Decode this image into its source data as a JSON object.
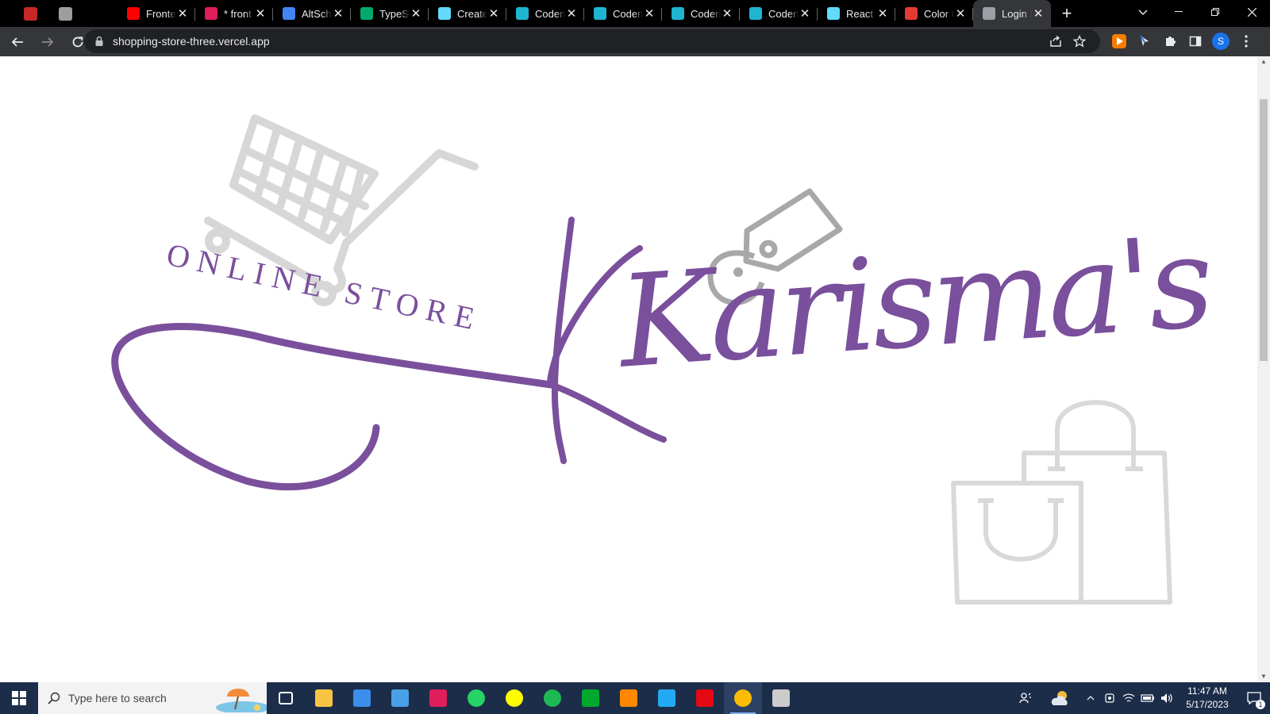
{
  "browser": {
    "pinned_tabs": [
      {
        "name": "pinned-tab-1",
        "color": "#c62828"
      },
      {
        "name": "pinned-tab-2",
        "color": "#9e9e9e"
      },
      {
        "name": "pinned-tab-3",
        "color": "#000000"
      }
    ],
    "tabs": [
      {
        "title": "Fronte",
        "icon": "youtube-icon",
        "color": "#ff0000"
      },
      {
        "title": "* front",
        "icon": "slack-icon",
        "color": "#e01e5a"
      },
      {
        "title": "AltSch",
        "icon": "docs-icon",
        "color": "#4285f4"
      },
      {
        "title": "TypeSc",
        "icon": "w3-icon",
        "color": "#04aa6d"
      },
      {
        "title": "Create",
        "icon": "react-icon",
        "color": "#61dafb"
      },
      {
        "title": "Coderb",
        "icon": "coderbyte-icon",
        "color": "#1eb5d1"
      },
      {
        "title": "Coderb",
        "icon": "coderbyte-icon",
        "color": "#1eb5d1"
      },
      {
        "title": "Coderb",
        "icon": "coderbyte-icon",
        "color": "#1eb5d1"
      },
      {
        "title": "Coderb",
        "icon": "coderbyte-icon",
        "color": "#1eb5d1"
      },
      {
        "title": "React /",
        "icon": "react-icon",
        "color": "#61dafb"
      },
      {
        "title": "Color C",
        "icon": "color-icon",
        "color": "#e53935"
      },
      {
        "title": "Login I",
        "icon": "globe-icon",
        "color": "#9aa0a6",
        "active": true
      }
    ],
    "new_tab_label": "+",
    "address_url": "shopping-store-three.vercel.app",
    "profile_initial": "S"
  },
  "logo": {
    "tagline": "ONLINE STORE",
    "brand": "Karisma's",
    "colors": {
      "purple": "#7a4f9c",
      "gray": "#cfcfcf",
      "tag_gray": "#a5a5a5"
    }
  },
  "taskbar": {
    "search_placeholder": "Type here to search",
    "time": "11:47 AM",
    "date": "5/17/2023",
    "notification_count": "1",
    "apps": [
      "task-view-icon",
      "file-explorer-icon",
      "store-icon",
      "mail-icon",
      "slack-icon",
      "whatsapp-icon",
      "snapchat-icon",
      "spotify-icon",
      "evernote-icon",
      "vlc-icon",
      "vscode-icon",
      "netflix-icon",
      "chrome-icon",
      "terminal-icon"
    ]
  }
}
